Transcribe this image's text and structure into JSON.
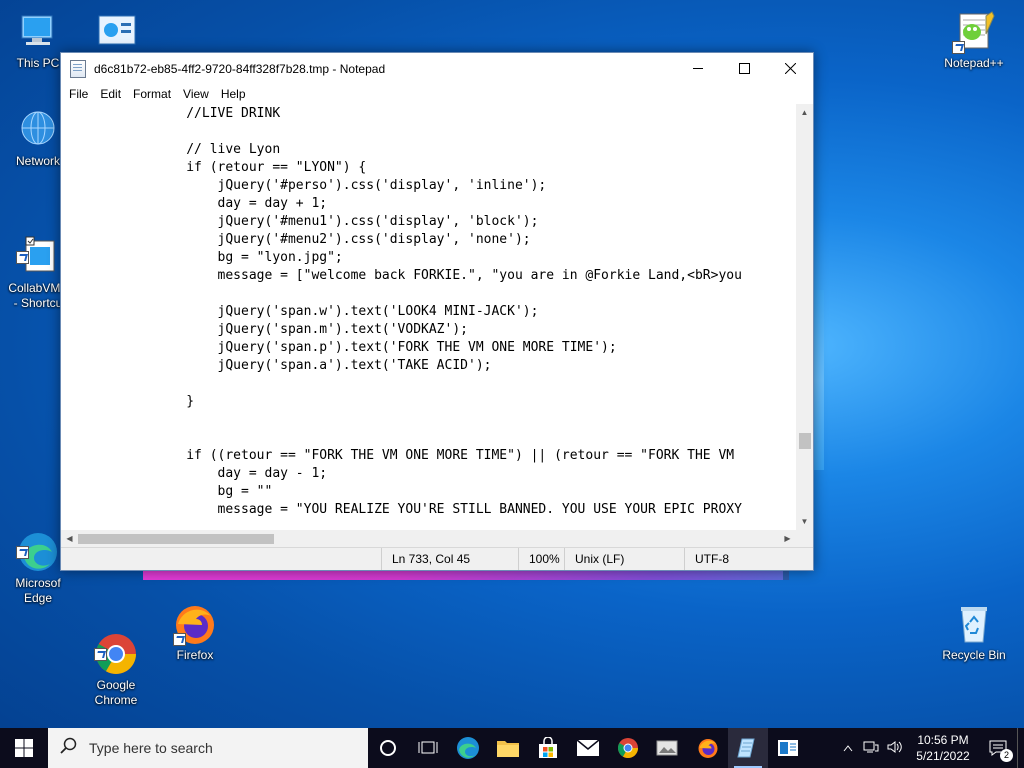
{
  "desktop": {
    "icons": [
      {
        "label": "This PC",
        "icon": "computer-icon"
      },
      {
        "label": "",
        "icon": "control-panel-icon"
      },
      {
        "label": "Network",
        "icon": "network-icon"
      },
      {
        "label": "CollabVMF\n- Shortcu",
        "icon": "app-shortcut-icon"
      },
      {
        "label": "Microsof\nEdge",
        "icon": "edge-icon"
      },
      {
        "label": "Google\nChrome",
        "icon": "chrome-icon"
      },
      {
        "label": "Firefox",
        "icon": "firefox-icon"
      },
      {
        "label": "Notepad++",
        "icon": "notepadpp-icon"
      },
      {
        "label": "Recycle Bin",
        "icon": "recycle-bin-icon"
      }
    ]
  },
  "notepad": {
    "title": "d6c81b72-eb85-4ff2-9720-84ff328f7b28.tmp - Notepad",
    "menu": [
      "File",
      "Edit",
      "Format",
      "View",
      "Help"
    ],
    "content": "                //LIVE DRINK\n\n                // live Lyon\n                if (retour == \"LYON\") {\n                    jQuery('#perso').css('display', 'inline');\n                    day = day + 1;\n                    jQuery('#menu1').css('display', 'block');\n                    jQuery('#menu2').css('display', 'none');\n                    bg = \"lyon.jpg\";\n                    message = [\"welcome back FORKIE.\", \"you are in @Forkie Land,<bR>you\n\n                    jQuery('span.w').text('LOOK4 MINI-JACK');\n                    jQuery('span.m').text('VODKAZ');\n                    jQuery('span.p').text('FORK THE VM ONE MORE TIME');\n                    jQuery('span.a').text('TAKE ACID');\n\n                }\n\n\n                if ((retour == \"FORK THE VM ONE MORE TIME\") || (retour == \"FORK THE VM\n                    day = day - 1;\n                    bg = \"\"\n                    message = \"YOU REALIZE YOU'RE STILL BANNED. YOU USE YOUR EPIC PROXY",
    "status": {
      "position": "Ln 733, Col 45",
      "zoom": "100%",
      "line_ending": "Unix (LF)",
      "encoding": "UTF-8"
    }
  },
  "taskbar": {
    "search_placeholder": "Type here to search",
    "time": "10:56 PM",
    "date": "5/21/2022",
    "notification_count": "2",
    "pinned": [
      "task-view-icon",
      "cortana-icon",
      "edge-icon",
      "file-explorer-icon",
      "store-icon",
      "mail-icon",
      "chrome-icon",
      "photos-icon",
      "firefox-icon",
      "notepad-icon",
      "app-icon"
    ]
  },
  "colors": {
    "taskbar": "#0c0c1c",
    "desktop_accent": "#0a64c8"
  }
}
